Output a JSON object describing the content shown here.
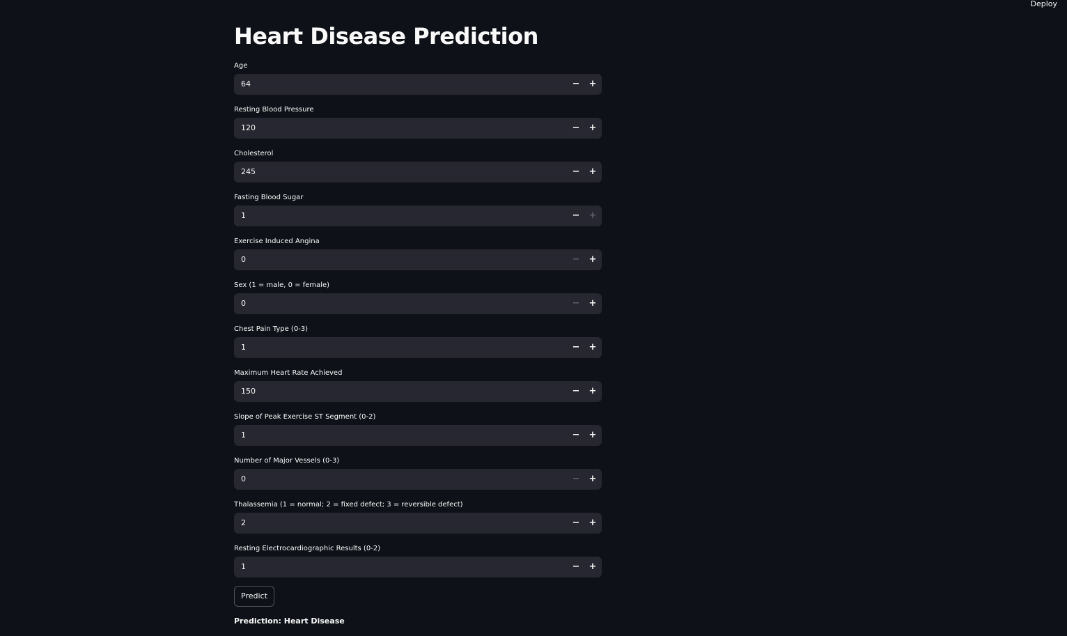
{
  "header": {
    "deploy_label": "Deploy"
  },
  "page": {
    "title": "Heart Disease Prediction"
  },
  "fields": [
    {
      "label": "Age",
      "value": "64",
      "minus_disabled": false,
      "plus_disabled": false
    },
    {
      "label": "Resting Blood Pressure",
      "value": "120",
      "minus_disabled": false,
      "plus_disabled": false
    },
    {
      "label": "Cholesterol",
      "value": "245",
      "minus_disabled": false,
      "plus_disabled": false
    },
    {
      "label": "Fasting Blood Sugar",
      "value": "1",
      "minus_disabled": false,
      "plus_disabled": true
    },
    {
      "label": "Exercise Induced Angina",
      "value": "0",
      "minus_disabled": true,
      "plus_disabled": false
    },
    {
      "label": "Sex (1 = male, 0 = female)",
      "value": "0",
      "minus_disabled": true,
      "plus_disabled": false
    },
    {
      "label": "Chest Pain Type (0-3)",
      "value": "1",
      "minus_disabled": false,
      "plus_disabled": false
    },
    {
      "label": "Maximum Heart Rate Achieved",
      "value": "150",
      "minus_disabled": false,
      "plus_disabled": false
    },
    {
      "label": "Slope of Peak Exercise ST Segment (0-2)",
      "value": "1",
      "minus_disabled": false,
      "plus_disabled": false
    },
    {
      "label": "Number of Major Vessels (0-3)",
      "value": "0",
      "minus_disabled": true,
      "plus_disabled": false
    },
    {
      "label": "Thalassemia (1 = normal; 2 = fixed defect; 3 = reversible defect)",
      "value": "2",
      "minus_disabled": false,
      "plus_disabled": false
    },
    {
      "label": "Resting Electrocardiographic Results (0-2)",
      "value": "1",
      "minus_disabled": false,
      "plus_disabled": false
    }
  ],
  "stepper": {
    "minus_symbol": "−",
    "plus_symbol": "+"
  },
  "actions": {
    "predict_label": "Predict"
  },
  "result": {
    "text": "Prediction: Heart Disease"
  },
  "colors": {
    "background": "#0e1117",
    "input_background": "#262730",
    "text": "#fafafa",
    "disabled": "#5d5f69"
  }
}
